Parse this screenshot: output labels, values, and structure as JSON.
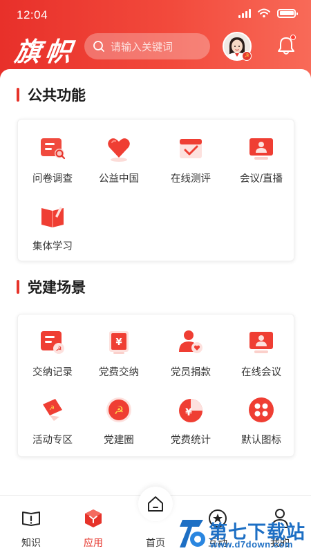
{
  "status_bar": {
    "time": "12:04"
  },
  "header": {
    "logo_text": "旗帜",
    "search": {
      "placeholder": "请输入关键词"
    }
  },
  "sections": [
    {
      "title": "公共功能",
      "items": [
        {
          "label": "问卷调查",
          "icon": "survey-icon"
        },
        {
          "label": "公益中国",
          "icon": "heart-icon"
        },
        {
          "label": "在线测评",
          "icon": "check-calendar-icon"
        },
        {
          "label": "会议/直播",
          "icon": "meeting-screen-icon"
        },
        {
          "label": "集体学习",
          "icon": "study-book-icon"
        }
      ]
    },
    {
      "title": "党建场景",
      "items": [
        {
          "label": "交纳记录",
          "icon": "record-icon"
        },
        {
          "label": "党费交纳",
          "icon": "fee-pay-icon"
        },
        {
          "label": "党员捐款",
          "icon": "donate-icon"
        },
        {
          "label": "在线会议",
          "icon": "online-meeting-icon"
        },
        {
          "label": "活动专区",
          "icon": "flag-icon"
        },
        {
          "label": "党建圈",
          "icon": "party-circle-icon"
        },
        {
          "label": "党费统计",
          "icon": "pie-stat-icon"
        },
        {
          "label": "默认图标",
          "icon": "default-grid-icon"
        }
      ]
    }
  ],
  "tabbar": {
    "items": [
      {
        "label": "知识",
        "icon": "book-icon"
      },
      {
        "label": "应用",
        "icon": "app-cube-icon",
        "active": true
      },
      {
        "label": "首页",
        "icon": "home-icon"
      },
      {
        "label": "互动",
        "icon": "star-circle-icon"
      },
      {
        "label": "我的",
        "icon": "person-icon"
      }
    ]
  },
  "watermark": {
    "title": "第七下载站",
    "url": "www.d7down.com"
  },
  "colors": {
    "primary": "#e6332a",
    "header_gradient_end": "#f86a58"
  }
}
